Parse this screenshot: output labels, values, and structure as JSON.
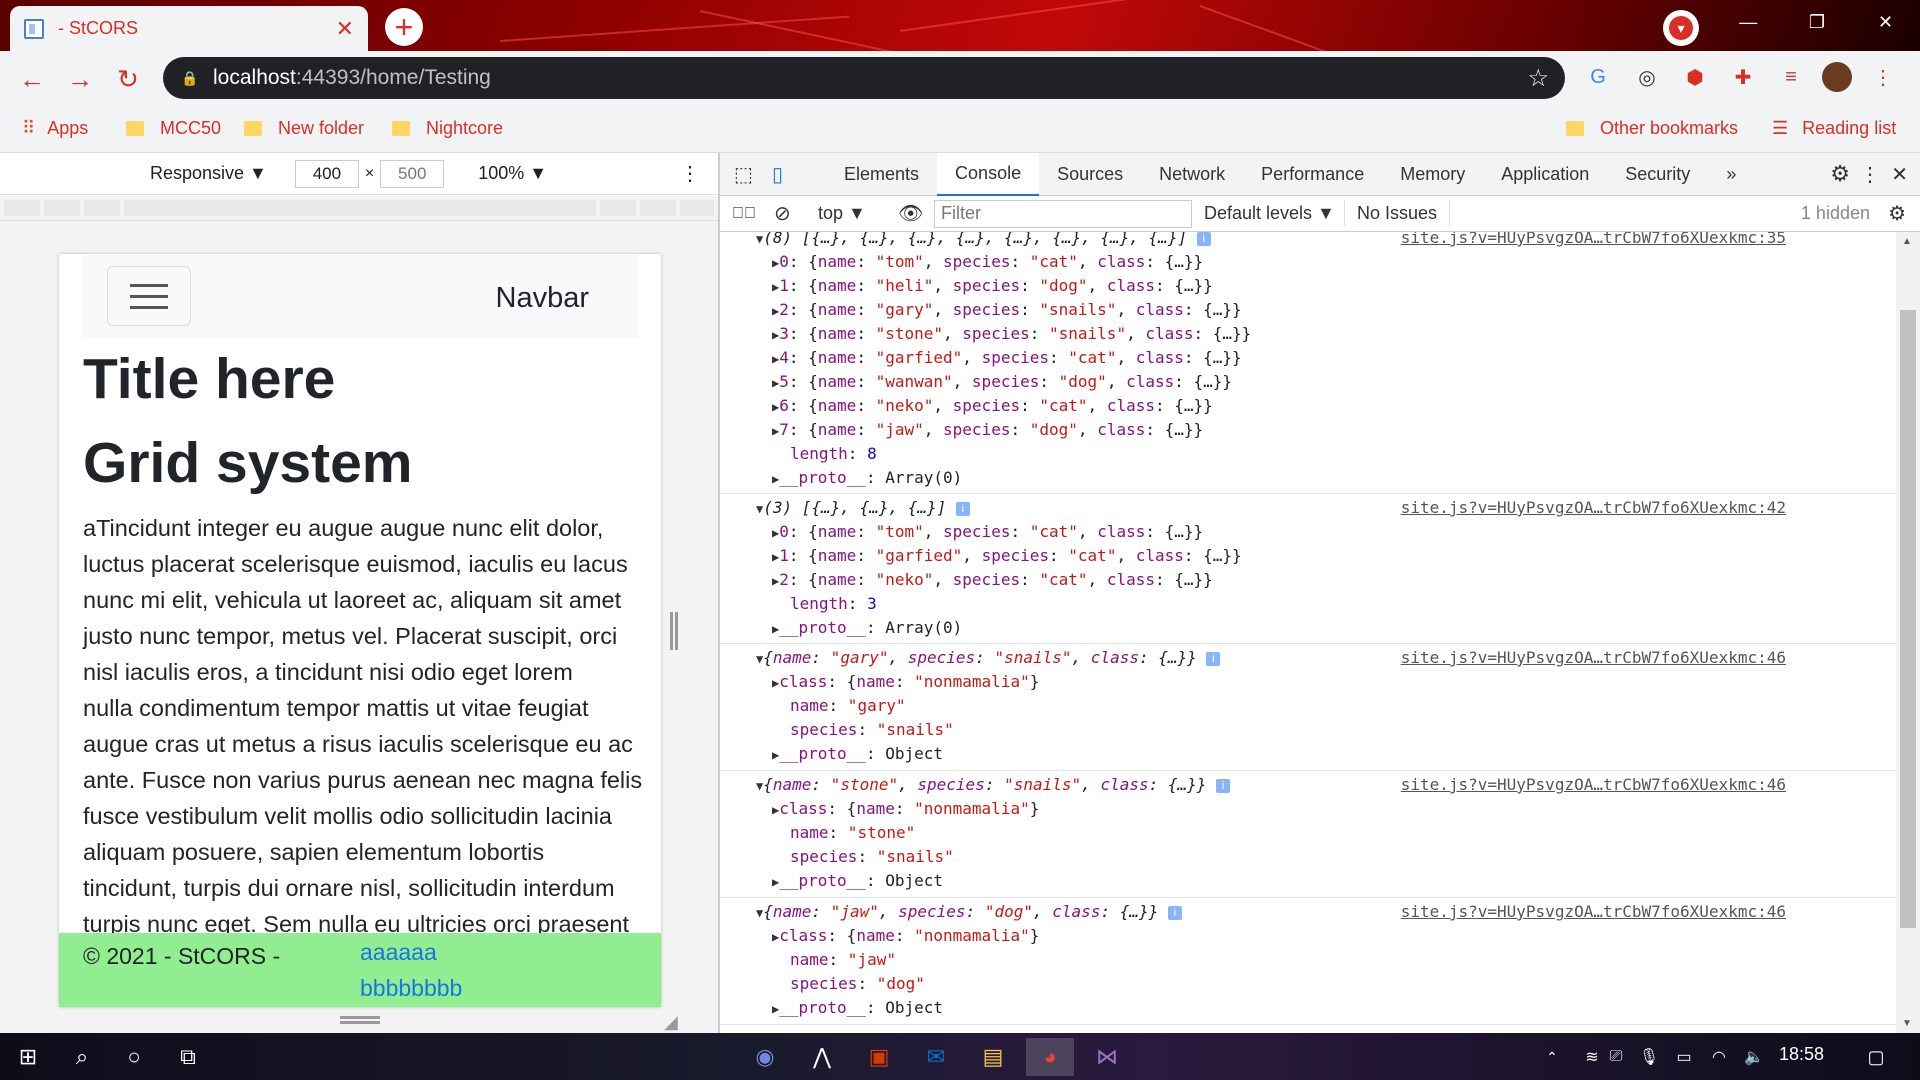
{
  "browser": {
    "tab_title": "- StCORS",
    "tab_close": "✕",
    "new_tab": "+",
    "url_host": "localhost",
    "url_path": ":44393/home/Testing",
    "window_controls": [
      "—",
      "❐",
      "✕"
    ]
  },
  "bookmarks": {
    "apps": "Apps",
    "items": [
      "MCC50",
      "New folder",
      "Nightcore"
    ],
    "other": "Other bookmarks",
    "reading_list": "Reading list"
  },
  "device_toolbar": {
    "mode": "Responsive ▼",
    "width": "400",
    "times": "×",
    "height": "500",
    "zoom": "100% ▼"
  },
  "page": {
    "brand": "Navbar",
    "title": "Title here",
    "heading": "Grid system",
    "body_lines": [
      "aTincidunt integer eu augue augue nunc elit dolor,",
      "luctus placerat scelerisque euismod, iaculis eu lacus",
      "nunc mi elit, vehicula ut laoreet ac, aliquam sit amet",
      "justo nunc tempor, metus vel. Placerat suscipit, orci",
      "nisl iaculis eros, a tincidunt nisi odio eget lorem",
      "nulla condimentum tempor mattis ut vitae feugiat",
      "augue cras ut metus a risus iaculis scelerisque eu ac",
      "ante. Fusce non varius purus aenean nec magna felis",
      "fusce vestibulum velit mollis odio sollicitudin lacinia",
      "aliquam posuere, sapien elementum lobortis",
      "tincidunt, turpis dui ornare nisl, sollicitudin interdum",
      "turpis nunc eget. Sem nulla eu ultricies orci praesent"
    ],
    "footer_copy": "© 2021 - StCORS -",
    "footer_link_1": "aaaaaa",
    "footer_link_2": "bbbbbbbb"
  },
  "devtools": {
    "tabs": [
      "Elements",
      "Console",
      "Sources",
      "Network",
      "Performance",
      "Memory",
      "Application",
      "Security",
      "»"
    ],
    "active_tab": "Console",
    "context": "top ▼",
    "filter_placeholder": "Filter",
    "levels": "Default levels ▼",
    "issues": "No Issues",
    "hidden": "1 hidden"
  },
  "console": {
    "messages": [
      {
        "header": "(8) [{…}, {…}, {…}, {…}, {…}, {…}, {…}, {…}]",
        "source": "site.js?v=HUyPsvgzOA…trCbW7fo6XUexkmc:35",
        "rows": [
          [
            "0",
            "tom",
            "cat"
          ],
          [
            "1",
            "heli",
            "dog"
          ],
          [
            "2",
            "gary",
            "snails"
          ],
          [
            "3",
            "stone",
            "snails"
          ],
          [
            "4",
            "garfied",
            "cat"
          ],
          [
            "5",
            "wanwan",
            "dog"
          ],
          [
            "6",
            "neko",
            "cat"
          ],
          [
            "7",
            "jaw",
            "dog"
          ]
        ],
        "length": "8",
        "proto": "Array(0)"
      },
      {
        "header": "(3) [{…}, {…}, {…}]",
        "source": "site.js?v=HUyPsvgzOA…trCbW7fo6XUexkmc:42",
        "rows": [
          [
            "0",
            "tom",
            "cat"
          ],
          [
            "1",
            "garfied",
            "cat"
          ],
          [
            "2",
            "neko",
            "cat"
          ]
        ],
        "length": "3",
        "proto": "Array(0)"
      },
      {
        "name": "gary",
        "species": "snails",
        "class_name": "nonmamalia",
        "source": "site.js?v=HUyPsvgzOA…trCbW7fo6XUexkmc:46",
        "proto": "Object"
      },
      {
        "name": "stone",
        "species": "snails",
        "class_name": "nonmamalia",
        "source": "site.js?v=HUyPsvgzOA…trCbW7fo6XUexkmc:46",
        "proto": "Object"
      },
      {
        "name": "jaw",
        "species": "dog",
        "class_name": "nonmamalia",
        "source": "site.js?v=HUyPsvgzOA…trCbW7fo6XUexkmc:46",
        "proto": "Object"
      }
    ]
  },
  "taskbar": {
    "time": "18:58"
  },
  "colors": {
    "accent": "#d93025",
    "footer_bg": "#90ee90",
    "link": "#1a73e8"
  }
}
